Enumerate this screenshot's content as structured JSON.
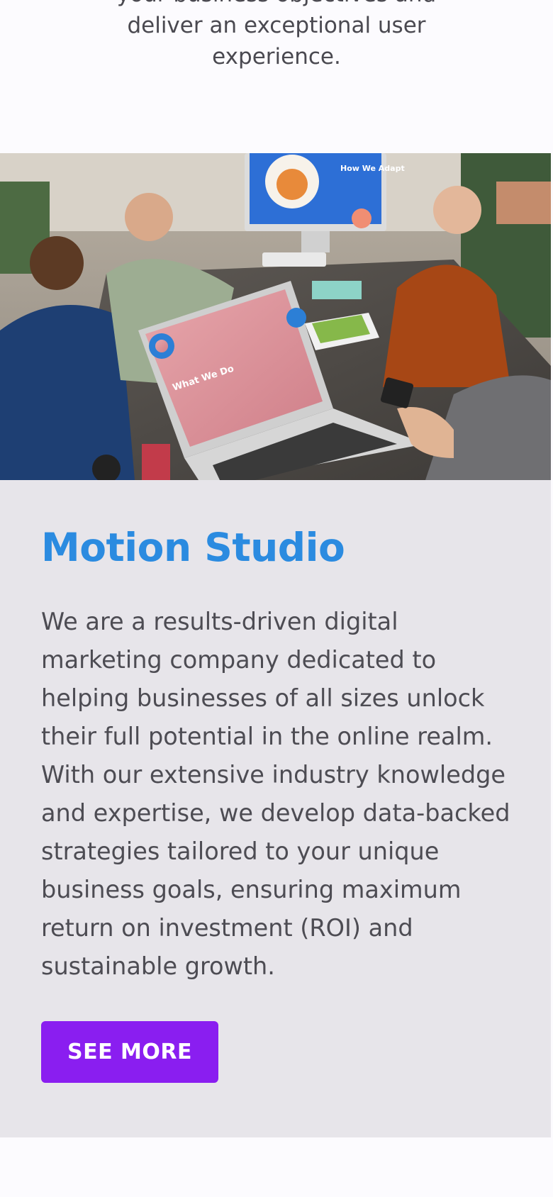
{
  "intro": {
    "text": "your business objectives and deliver an exceptional user experience."
  },
  "hero": {
    "image_description": "team-meeting-photo",
    "laptop_screen_text": "What We Do",
    "monitor_text": "How We Adapt"
  },
  "card": {
    "title": "Motion Studio",
    "body": "We are a results-driven digital marketing company dedicated to helping businesses of all sizes unlock their full potential in the online realm. With our extensive industry knowledge and expertise, we develop data-backed strategies tailored to your unique business goals, ensuring maximum return on investment (ROI) and sustainable growth.",
    "button_label": "SEE MORE"
  },
  "colors": {
    "title": "#2b8be0",
    "button": "#8a1ef0",
    "card_bg": "#e7e5ea",
    "page_bg": "#fcfbfe"
  }
}
